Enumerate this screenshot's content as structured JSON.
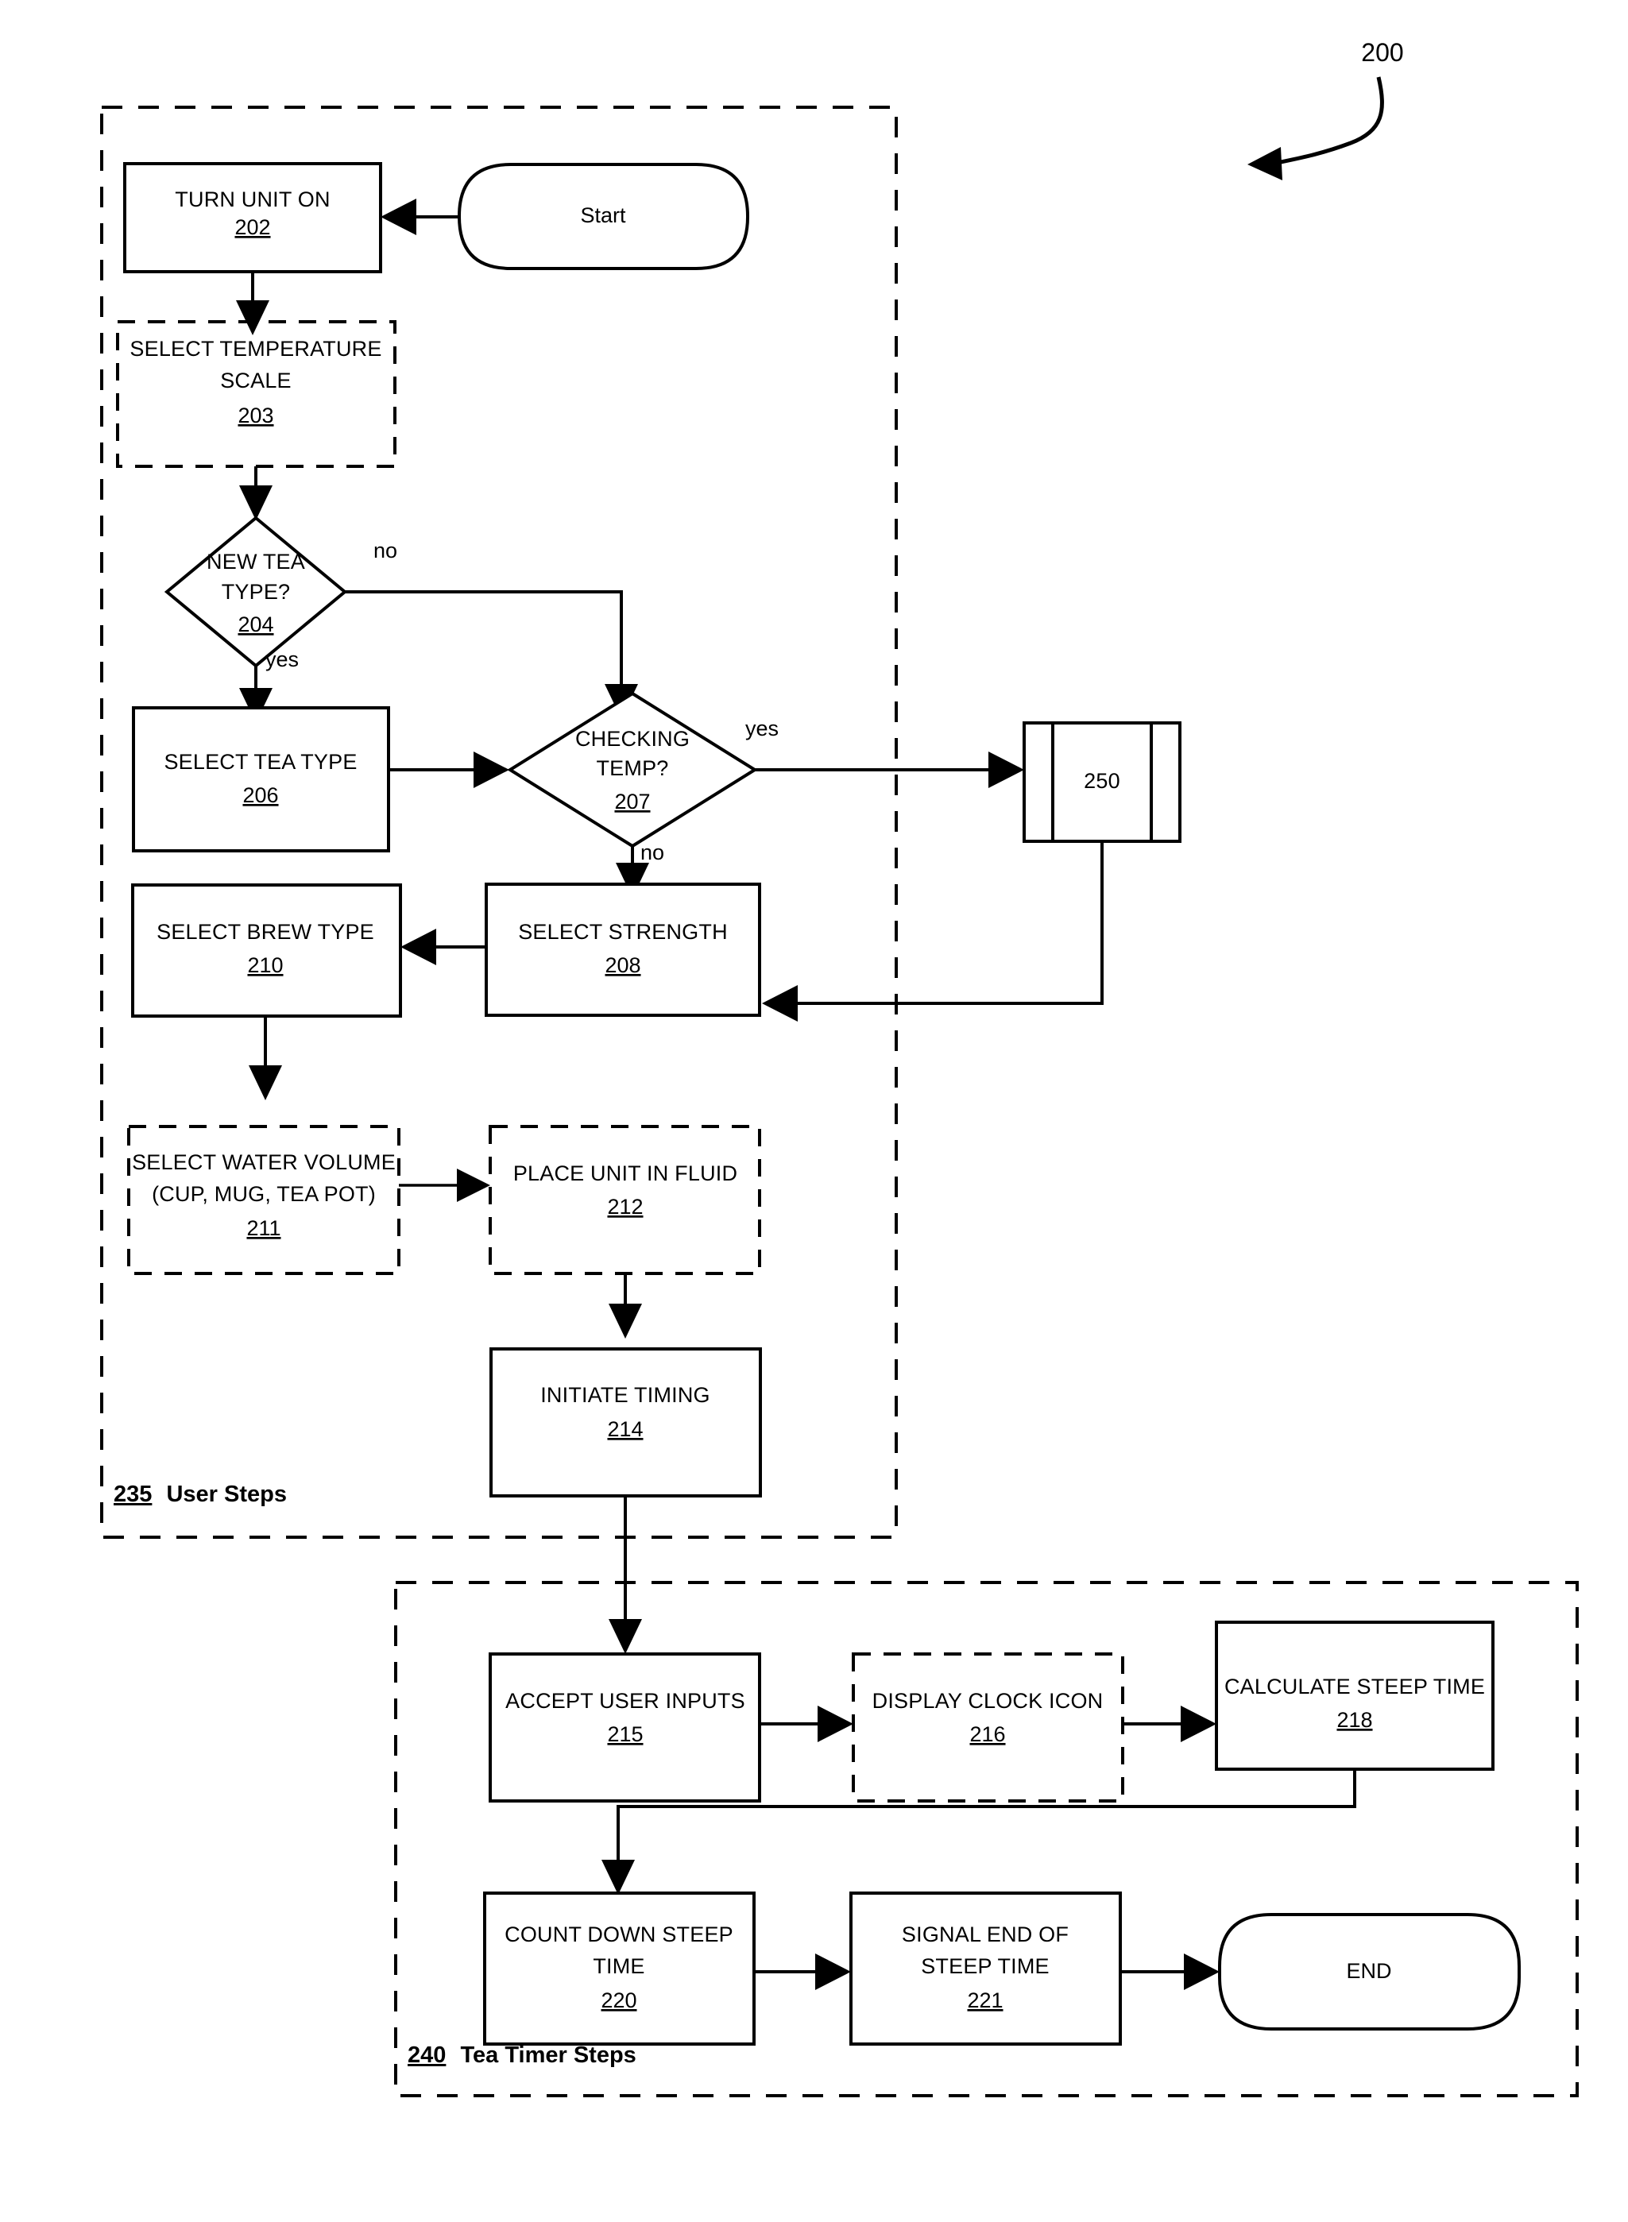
{
  "figure": {
    "number": "200",
    "title": "Tea brewing / tea timer process flowchart"
  },
  "groups": [
    {
      "id": "user-steps",
      "ref": "235",
      "label": "User Steps"
    },
    {
      "id": "tea-timer-steps",
      "ref": "240",
      "label": "Tea Timer Steps"
    }
  ],
  "nodes": {
    "start": {
      "label": "Start",
      "shape": "terminator"
    },
    "n202": {
      "label": "TURN UNIT ON",
      "ref": "202",
      "shape": "process"
    },
    "n203": {
      "label": "SELECT TEMPERATURE SCALE",
      "line1": "SELECT TEMPERATURE",
      "line2": "SCALE",
      "ref": "203",
      "shape": "process-optional"
    },
    "n204": {
      "label": "NEW TEA TYPE?",
      "line1": "NEW TEA",
      "line2": "TYPE?",
      "ref": "204",
      "shape": "decision"
    },
    "n206": {
      "label": "SELECT TEA TYPE",
      "ref": "206",
      "shape": "process"
    },
    "n207": {
      "label": "CHECKING TEMP?",
      "line1": "CHECKING",
      "line2": "TEMP?",
      "ref": "207",
      "shape": "decision"
    },
    "n250": {
      "label": "250",
      "ref": "250",
      "shape": "predefined-process"
    },
    "n208": {
      "label": "SELECT STRENGTH",
      "ref": "208",
      "shape": "process"
    },
    "n210": {
      "label": "SELECT  BREW TYPE",
      "ref": "210",
      "shape": "process"
    },
    "n211": {
      "label": "SELECT WATER VOLUME (CUP, MUG, TEA POT)",
      "line1": "SELECT WATER VOLUME",
      "line2": "(CUP, MUG, TEA POT)",
      "ref": "211",
      "shape": "process-optional"
    },
    "n212": {
      "label": "PLACE UNIT IN FLUID",
      "ref": "212",
      "shape": "process-optional"
    },
    "n214": {
      "label": "INITIATE TIMING",
      "ref": "214",
      "shape": "process"
    },
    "n215": {
      "label": "ACCEPT USER INPUTS",
      "ref": "215",
      "shape": "process"
    },
    "n216": {
      "label": "DISPLAY CLOCK ICON",
      "ref": "216",
      "shape": "process-optional"
    },
    "n218": {
      "label": "CALCULATE STEEP TIME",
      "ref": "218",
      "shape": "process"
    },
    "n220": {
      "label": "COUNT DOWN STEEP TIME",
      "line1": "COUNT DOWN STEEP",
      "line2": "TIME",
      "ref": "220",
      "shape": "process"
    },
    "n221": {
      "label": "SIGNAL END OF STEEP TIME",
      "line1": "SIGNAL END OF",
      "line2": "STEEP TIME",
      "ref": "221",
      "shape": "process"
    },
    "end": {
      "label": "END",
      "shape": "terminator"
    }
  },
  "edge_labels": {
    "new_tea_type_no": "no",
    "new_tea_type_yes": "yes",
    "checking_temp_yes": "yes",
    "checking_temp_no": "no"
  },
  "colors": {
    "stroke": "#000000",
    "background": "#ffffff"
  }
}
